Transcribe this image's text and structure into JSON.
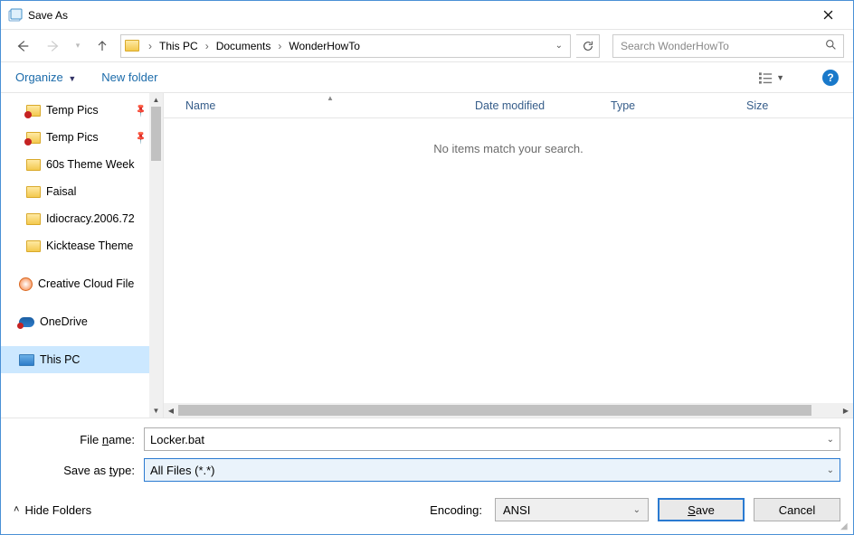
{
  "window": {
    "title": "Save As"
  },
  "nav": {
    "breadcrumb": [
      "This PC",
      "Documents",
      "WonderHowTo"
    ]
  },
  "search": {
    "placeholder": "Search WonderHowTo"
  },
  "toolbar": {
    "organize": "Organize",
    "new_folder": "New folder"
  },
  "tree": {
    "items": [
      {
        "label": "Temp Pics",
        "icon": "folder-redx",
        "pinned": true
      },
      {
        "label": "Temp Pics",
        "icon": "folder-redx",
        "pinned": true
      },
      {
        "label": "60s Theme Week",
        "icon": "folder"
      },
      {
        "label": "Faisal",
        "icon": "folder"
      },
      {
        "label": "Idiocracy.2006.72",
        "icon": "folder"
      },
      {
        "label": "Kicktease Theme",
        "icon": "folder"
      },
      {
        "label": "Creative Cloud File",
        "icon": "cc",
        "spaced": true,
        "drive": true
      },
      {
        "label": "OneDrive",
        "icon": "onedrive",
        "spaced": true,
        "drive": true
      },
      {
        "label": "This PC",
        "icon": "thispc",
        "spaced": true,
        "drive": true,
        "selected": true
      }
    ]
  },
  "columns": {
    "name": "Name",
    "date": "Date modified",
    "type": "Type",
    "size": "Size"
  },
  "main": {
    "empty_text": "No items match your search."
  },
  "form": {
    "file_name_label_pre": "File ",
    "file_name_label_ul": "n",
    "file_name_label_post": "ame:",
    "file_name_value": "Locker.bat",
    "save_type_label_pre": "Save as ",
    "save_type_label_ul": "t",
    "save_type_label_post": "ype:",
    "save_type_value": "All Files  (*.*)"
  },
  "footer": {
    "hide_folders": "Hide Folders",
    "encoding_label": "Encoding:",
    "encoding_value": "ANSI",
    "save_ul": "S",
    "save_post": "ave",
    "cancel": "Cancel"
  }
}
